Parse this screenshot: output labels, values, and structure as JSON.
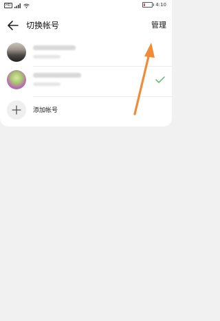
{
  "status_bar": {
    "network_label": "HD",
    "signal_icon": "signal-icon",
    "wifi_icon": "wifi-icon",
    "battery_level": 0.15,
    "time": "4:10"
  },
  "header": {
    "back_icon": "back-arrow-icon",
    "title": "切换帐号",
    "manage_label": "管理"
  },
  "accounts": [
    {
      "name": "",
      "sub": "",
      "selected": false
    },
    {
      "name": "",
      "sub": "",
      "selected": true
    }
  ],
  "add_account": {
    "icon": "plus-icon",
    "label": "添加帐号"
  },
  "annotation": {
    "color": "#f08b38",
    "icon": "annotation-arrow-icon"
  },
  "colors": {
    "accent_check": "#5fb36a",
    "page_background": "#f1f1f1"
  }
}
